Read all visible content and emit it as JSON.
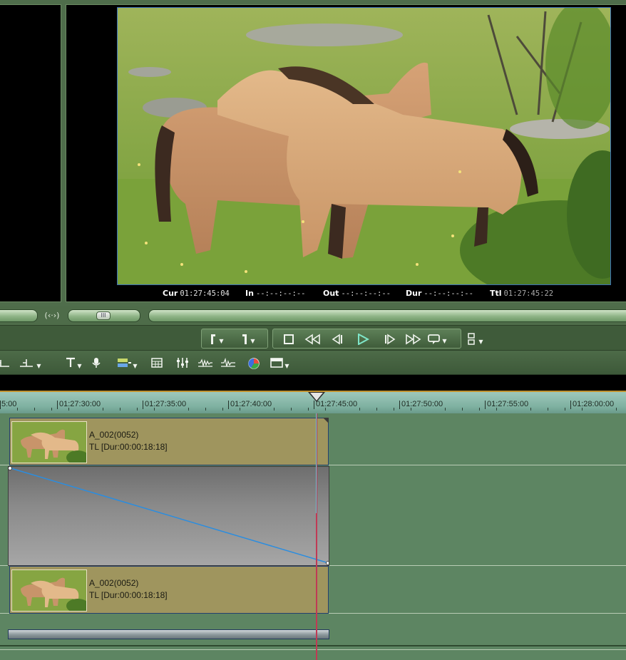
{
  "program_monitor": {
    "timecodes": {
      "cur_label": "Cur",
      "cur_value": "01:27:45:04",
      "in_label": "In",
      "in_value": "--:--:--:--",
      "out_label": "Out",
      "out_value": "--:--:--:--",
      "dur_label": "Dur",
      "dur_value": "--:--:--:--",
      "ttl_label": "Ttl",
      "ttl_value": "01:27:45:22"
    }
  },
  "transport": {
    "buttons": [
      "set-in",
      "set-out",
      "stop",
      "rewind",
      "step-back",
      "play",
      "step-forward",
      "fast-forward",
      "loop",
      "match-frame"
    ]
  },
  "toolbar": {
    "tools": [
      "trim",
      "split",
      "title",
      "voice-over",
      "add-effect",
      "multicam",
      "mixer",
      "waveform",
      "audio-meter",
      "color",
      "render"
    ]
  },
  "timeline": {
    "ruler_labels": [
      "5:00",
      "01:27:30:00",
      "01:27:35:00",
      "01:27:40:00",
      "01:27:45:00",
      "01:27:50:00",
      "01:27:55:00",
      "01:28:00:00"
    ],
    "clips": [
      {
        "title": "A_002(0052)",
        "duration": "TL [Dur:00:00:18:18]"
      },
      {
        "title": "A_002(0052)",
        "duration": "TL [Dur:00:00:18:18]"
      }
    ]
  },
  "colors": {
    "panel": "#4f6d4b",
    "clip": "#9f955e",
    "playhead": "#c03a55",
    "accent_play": "#7fe6c9"
  }
}
